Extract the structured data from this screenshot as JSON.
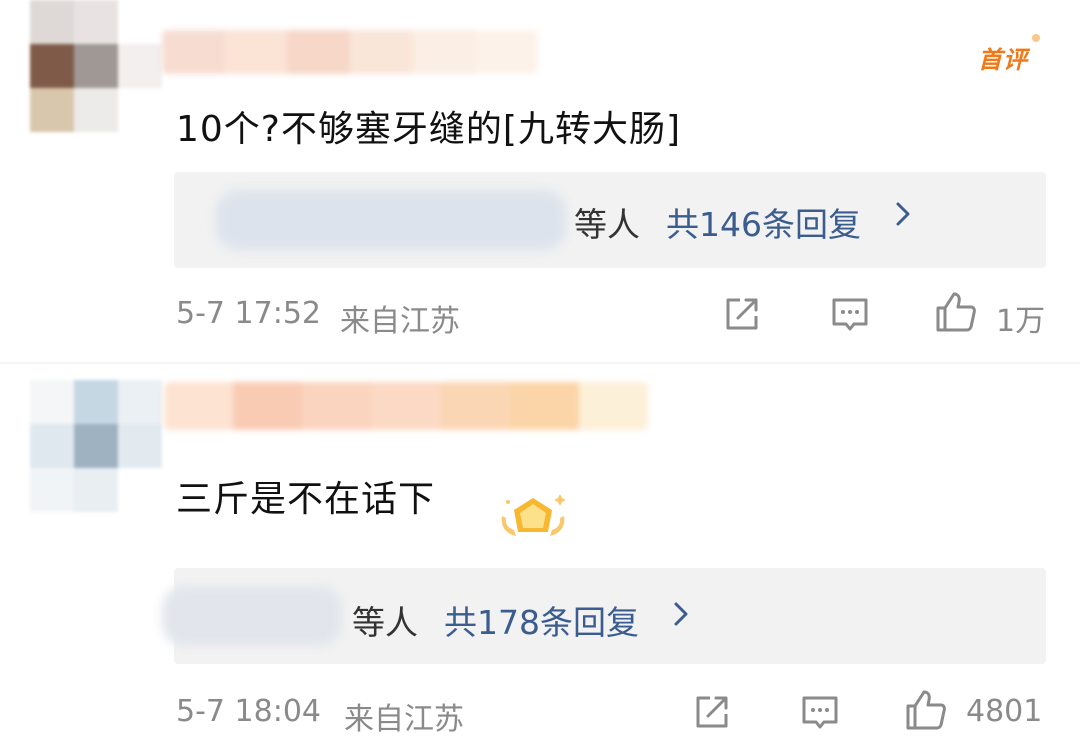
{
  "comments": [
    {
      "is_first_comment": true,
      "badge": "首评",
      "text": "10个?不够塞牙缝的[九转大肠]",
      "reply_others_label": "等人",
      "reply_count_label": "共146条回复",
      "time": "5-7 17:52",
      "location": "来自江苏",
      "like_count": "1万"
    },
    {
      "is_first_comment": false,
      "text": "三斤是不在话下",
      "has_medal": true,
      "reply_others_label": "等人",
      "reply_count_label": "共178条回复",
      "time": "5-7 18:04",
      "location": "来自江苏",
      "like_count": "4801"
    }
  ],
  "colors": {
    "link_blue": "#3b5c8f",
    "meta_gray": "#8a8a8a",
    "badge_orange": "#f07a18",
    "reply_bg": "#f2f2f2"
  },
  "icons": [
    "share-icon",
    "comment-icon",
    "thumbs-up-icon",
    "chevron-right-icon",
    "medal-icon"
  ]
}
